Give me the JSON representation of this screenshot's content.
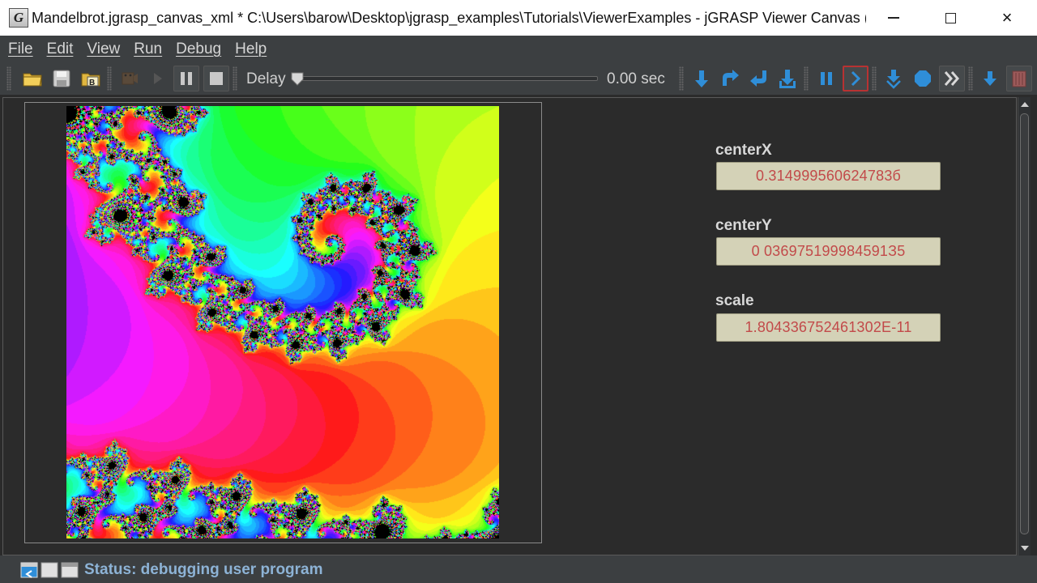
{
  "window": {
    "title": "Mandelbrot.jgrasp_canvas_xml *  C:\\Users\\barow\\Desktop\\jgrasp_examples\\Tutorials\\ViewerExamples - jGRASP Viewer Canvas (...",
    "app_icon_letter": "G",
    "controls": {
      "minimize": "minimize-icon",
      "maximize": "maximize-icon",
      "close": "×"
    }
  },
  "menu": {
    "items": [
      {
        "label": "File"
      },
      {
        "label": "Edit"
      },
      {
        "label": "View"
      },
      {
        "label": "Run"
      },
      {
        "label": "Debug"
      },
      {
        "label": "Help"
      }
    ]
  },
  "toolbar": {
    "delay_label": "Delay",
    "delay_value": "0.00 sec",
    "delay_slider_level": 0,
    "icons": [
      "open-folder-icon",
      "save-icon",
      "save-as-b-icon",
      "run-movie-icon",
      "play-icon",
      "pause-icon",
      "stop-icon",
      "step-icon",
      "step-over-icon",
      "step-in-icon",
      "step-out-icon",
      "suspend-icon",
      "resume-icon",
      "auto-step-icon",
      "auto-resume-icon",
      "fast-forward-icon",
      "push-icon",
      "pop-icon"
    ]
  },
  "fields": {
    "centerX": {
      "label": "centerX",
      "value": "0.314999560624783б"
    },
    "centerY": {
      "label": "centerY",
      "value": "0 036975199984591З5"
    },
    "scale": {
      "label": "scale",
      "value": "1.804336752461302E-11"
    }
  },
  "status": {
    "text": "Status: debugging user program"
  },
  "colors": {
    "accent_blue": "#2f8ed8",
    "field_bg": "#d4d2b7",
    "field_text": "#c24a4a",
    "status_text": "#8db3d6"
  }
}
